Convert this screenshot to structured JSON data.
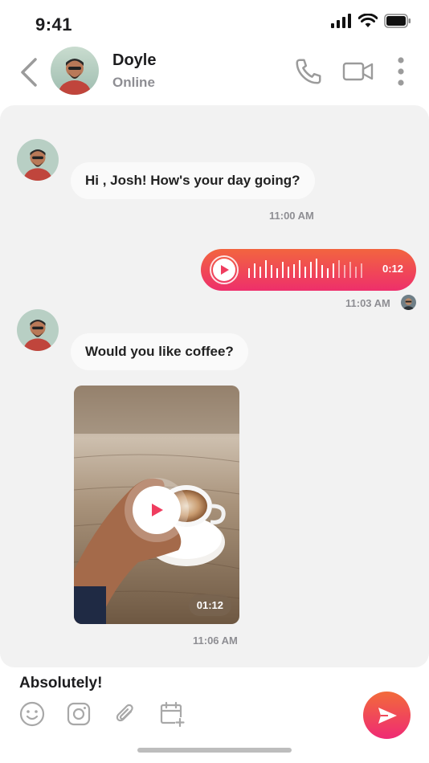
{
  "status_bar": {
    "time": "9:41"
  },
  "header": {
    "name": "Doyle",
    "presence": "Online"
  },
  "messages": [
    {
      "text": "Hi , Josh! How's your day going?",
      "time": "11:00 AM"
    },
    {
      "voice_duration": "0:12",
      "time": "11:03 AM"
    },
    {
      "text": "Would you like coffee?"
    },
    {
      "video_duration": "01:12",
      "time": "11:06 AM"
    }
  ],
  "composer": {
    "text": "Absolutely!"
  },
  "icons": {
    "back": "chevron-left-icon",
    "call": "phone-icon",
    "video_call": "video-camera-icon",
    "more": "more-vertical-icon",
    "emoji": "smile-icon",
    "camera": "instagram-camera-icon",
    "attach": "paperclip-icon",
    "schedule": "calendar-plus-icon",
    "send": "send-icon"
  },
  "colors": {
    "accent_start": "#f2653f",
    "accent_end": "#ee2f6b",
    "chat_bg": "#f2f2f2"
  }
}
